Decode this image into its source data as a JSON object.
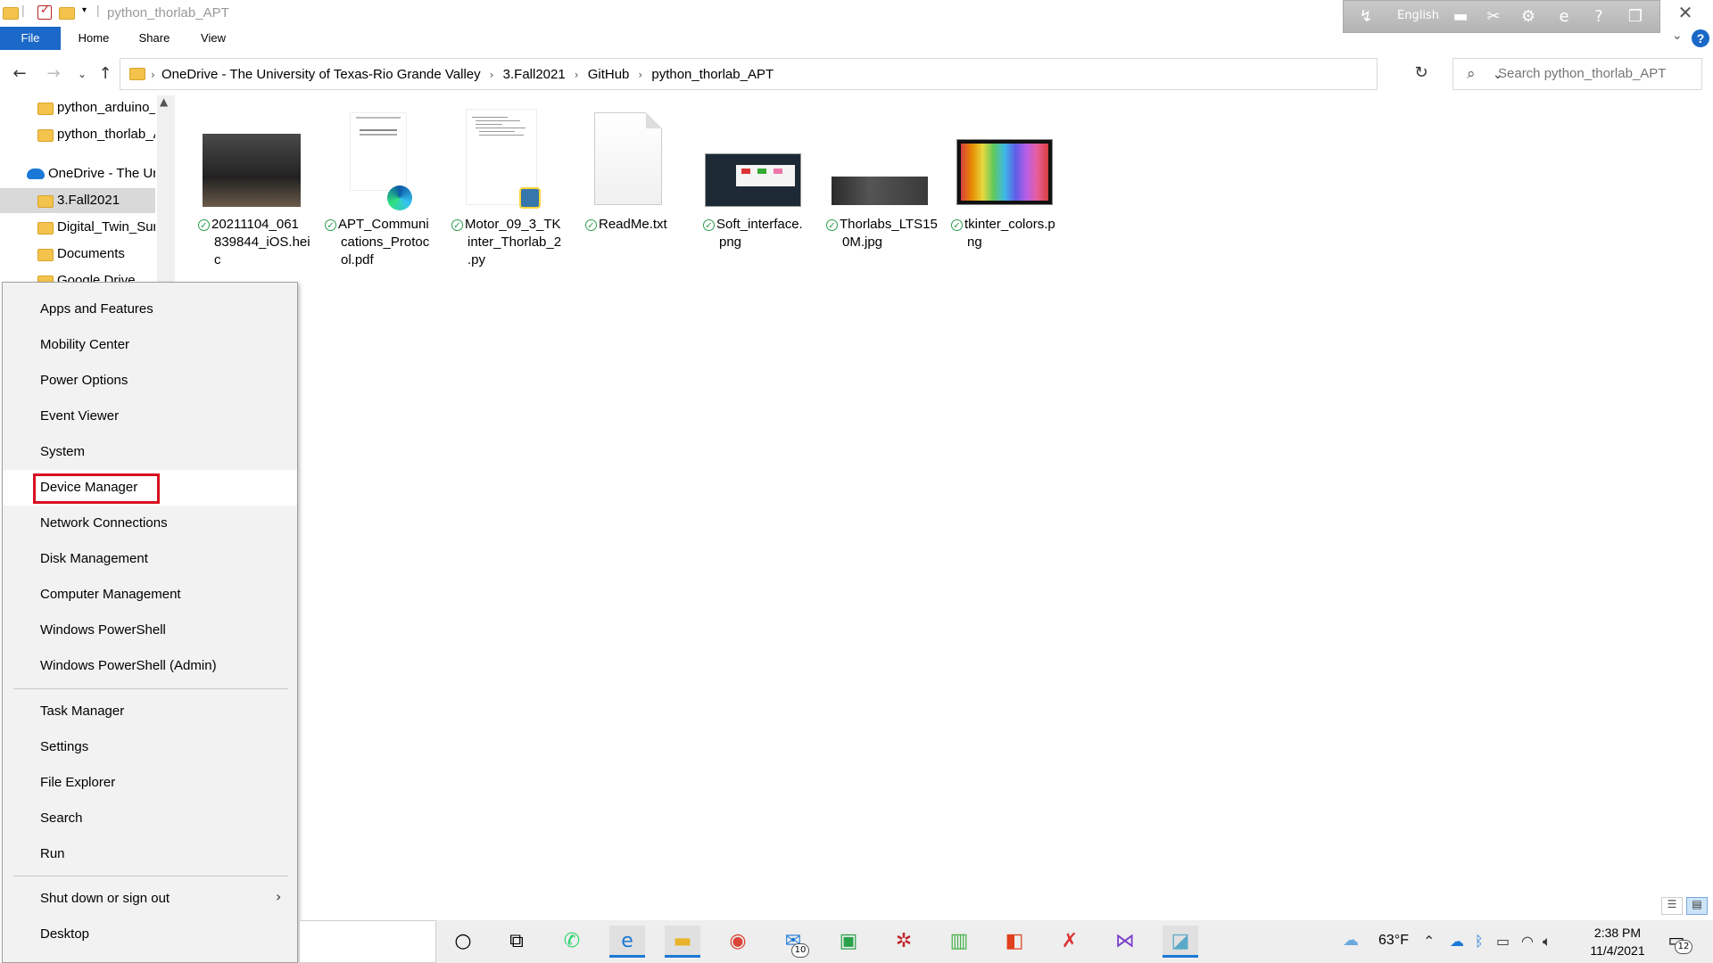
{
  "window": {
    "title": "python_thorlab_APT",
    "language": "English"
  },
  "ribbon": {
    "tabs": [
      "File",
      "Home",
      "Share",
      "View"
    ]
  },
  "address": {
    "crumbs": [
      "OneDrive - The University of Texas-Rio Grande Valley",
      "3.Fall2021",
      "GitHub",
      "python_thorlab_APT"
    ],
    "search_placeholder": "Search python_thorlab_APT"
  },
  "nav": {
    "items": [
      "python_arduino_",
      "python_thorlab_A",
      "OneDrive - The Ur",
      "3.Fall2021",
      "Digital_Twin_Sur",
      "Documents",
      "Google Drive"
    ]
  },
  "files": [
    {
      "name": "20211104_061839844_iOS.heic",
      "lines": [
        "20211104_061",
        "839844_iOS.hei",
        "c"
      ]
    },
    {
      "name": "APT_Communications_Protocol.pdf",
      "lines": [
        "APT_Communi",
        "cations_Protoc",
        "ol.pdf"
      ]
    },
    {
      "name": "Motor_09_3_TKinter_Thorlab_2.py",
      "lines": [
        "Motor_09_3_TK",
        "inter_Thorlab_2",
        ".py"
      ]
    },
    {
      "name": "ReadMe.txt",
      "lines": [
        "ReadMe.txt"
      ]
    },
    {
      "name": "Soft_interface.png",
      "lines": [
        "Soft_interface.",
        "png"
      ]
    },
    {
      "name": "Thorlabs_LTS150M.jpg",
      "lines": [
        "Thorlabs_LTS15",
        "0M.jpg"
      ]
    },
    {
      "name": "tkinter_colors.png",
      "lines": [
        "tkinter_colors.p",
        "ng"
      ]
    }
  ],
  "context_menu": {
    "items": [
      "Apps and Features",
      "Mobility Center",
      "Power Options",
      "Event Viewer",
      "System",
      "Device Manager",
      "Network Connections",
      "Disk Management",
      "Computer Management",
      "Windows PowerShell",
      "Windows PowerShell (Admin)",
      "Task Manager",
      "Settings",
      "File Explorer",
      "Search",
      "Run",
      "Shut down or sign out",
      "Desktop"
    ],
    "highlighted": "Device Manager"
  },
  "taskbar": {
    "temperature": "63°F",
    "time": "2:38 PM",
    "date": "11/4/2021",
    "mail_badge": "10",
    "notification_badge": "12"
  },
  "colors": {
    "accent": "#1a68c7",
    "highlight_box": "#d81020",
    "sync_ok": "#2a9d4a"
  }
}
